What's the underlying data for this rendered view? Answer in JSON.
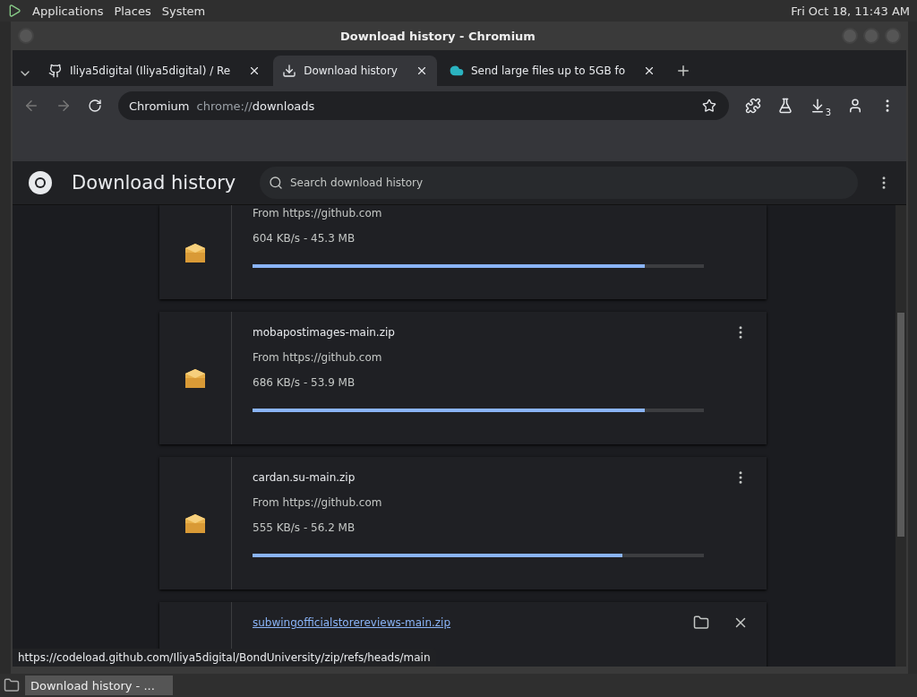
{
  "top_panel": {
    "menus": [
      "Applications",
      "Places",
      "System"
    ],
    "clock": "Fri Oct 18, 11:43 AM"
  },
  "window": {
    "title": "Download history - Chromium"
  },
  "tabs": [
    {
      "kind": "github",
      "label": "Iliya5digital (Iliya5digital) / Re",
      "selected": false
    },
    {
      "kind": "download",
      "label": "Download history",
      "selected": true
    },
    {
      "kind": "cloud",
      "label": "Send large files up to 5GB fo",
      "selected": false
    }
  ],
  "toolbar": {
    "site_chip": "Chromium",
    "url_scheme": "chrome://",
    "url_path": "downloads",
    "download_count": "3"
  },
  "page": {
    "title": "Download history",
    "search": {
      "placeholder": "Search download history"
    }
  },
  "downloads": [
    {
      "kind": "in_progress",
      "source": "From https://github.com",
      "status": "604 KB/s - 45.3 MB",
      "level": 0.87
    },
    {
      "kind": "in_progress",
      "name": "mobapostimages-main.zip",
      "source": "From https://github.com",
      "status": "686 KB/s - 53.9 MB",
      "level": 0.87
    },
    {
      "kind": "in_progress",
      "name": "cardan.su-main.zip",
      "source": "From https://github.com",
      "status": "555 KB/s - 56.2 MB",
      "level": 0.82
    },
    {
      "kind": "complete",
      "name": "subwingofficialstorereviews-main.zip"
    }
  ],
  "status_bubble": "https://codeload.github.com/Iliya5digital/BondUniversity/zip/refs/heads/main",
  "taskbar": {
    "items": [
      {
        "label": "Download history - ...",
        "selected": true
      }
    ]
  }
}
